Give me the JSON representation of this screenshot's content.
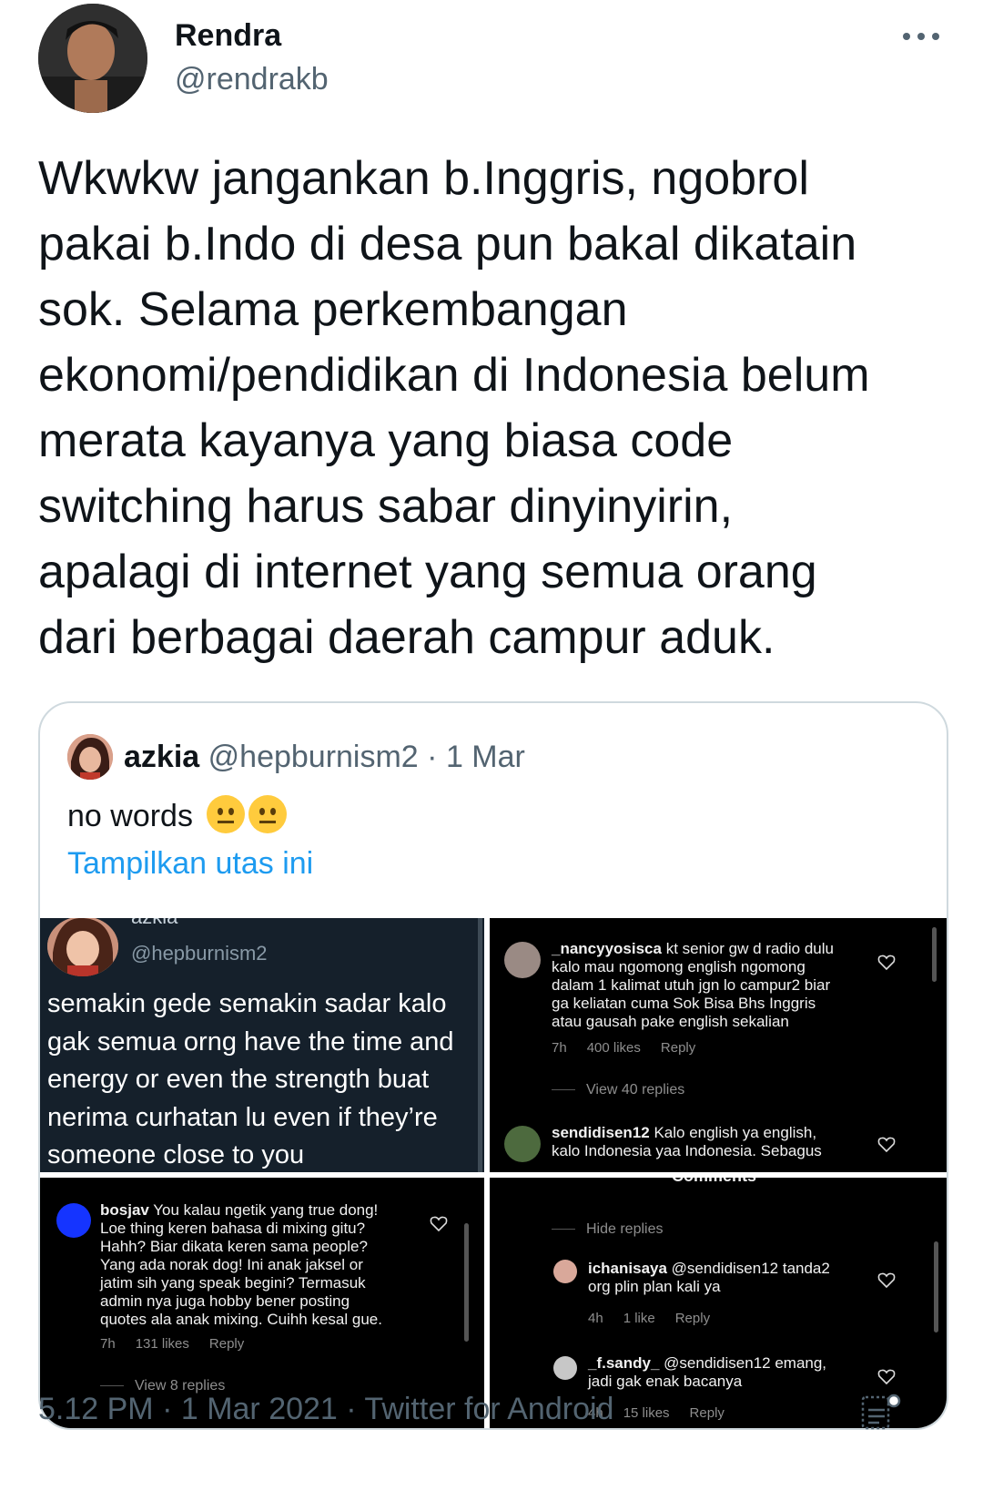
{
  "tweet": {
    "author_name": "Rendra",
    "author_handle": "@rendrakb",
    "text": "Wkwkw jangankan b.Inggris, ngobrol\npakai b.Indo di desa pun bakal dikatain\nsok. Selama perkembangan\nekonomi/pendidikan di Indonesia belum\nmerata kayanya yang biasa code\nswitching harus sabar dinyinyirin,\napalagi di internet yang semua orang\ndari berbagai daerah campur aduk.",
    "footer": "5.12 PM · 1 Mar 2021 · Twitter for Android"
  },
  "quote": {
    "name": "azkia",
    "handle": "@hepburnism2",
    "date": "· 1 Mar",
    "text": "no words",
    "show_thread": "Tampilkan utas ini",
    "emoji": [
      "neutral-face-icon",
      "neutral-face-icon"
    ]
  },
  "media": {
    "panel1": {
      "name": "azkia",
      "handle": "@hepburnism2",
      "text": "semakin gede semakin sadar kalo\ngak semua orng have the time and\nenergy or even the strength buat\nnerima curhatan lu even if they’re\nsomeone close to you"
    },
    "panel2": {
      "comment1_user": "_nancyyosisca",
      "comment1_text": " kt senior gw d radio dulu\nkalo mau ngomong english ngomong\ndalam 1 kalimat utuh jgn lo campur2 biar\nga keliatan cuma Sok Bisa Bhs Inggris\natau gausah pake english sekalian",
      "comment1_time": "7h",
      "comment1_likes": "400 likes",
      "comment1_reply": "Reply",
      "view_replies": "View 40 replies",
      "comment2_user": "sendidisen12",
      "comment2_text": " Kalo english ya english,\nkalo Indonesia yaa Indonesia. Sebagus"
    },
    "panel3": {
      "user": "bosjav",
      "text": " You kalau ngetik yang true dong!\nLoe thing keren bahasa di mixing gitu?\nHahh? Biar dikata keren sama people?\nYang ada norak dog! Ini anak jaksel or\njatim sih yang speak begini? Termasuk\nadmin nya juga hobby bener posting\nquotes ala anak mixing. Cuihh kesal gue.",
      "time": "7h",
      "likes": "131 likes",
      "reply": "Reply",
      "view_replies": "View 8 replies"
    },
    "panel4": {
      "header": "Comments",
      "hide_replies": "Hide replies",
      "r1_user": "ichanisaya",
      "r1_text": " @sendidisen12 tanda2\norg plin plan kali ya",
      "r1_time": "4h",
      "r1_likes": "1 like",
      "r1_reply": "Reply",
      "r2_user": "_f.sandy_",
      "r2_text": " @sendidisen12 emang,\njadi gak enak bacanya",
      "r2_time": "4h",
      "r2_likes": "15 likes",
      "r2_reply": "Reply"
    }
  },
  "colors": {
    "text": "#0f1419",
    "secondary": "#536471",
    "link": "#1d9bf0",
    "border": "#cfd9de"
  }
}
